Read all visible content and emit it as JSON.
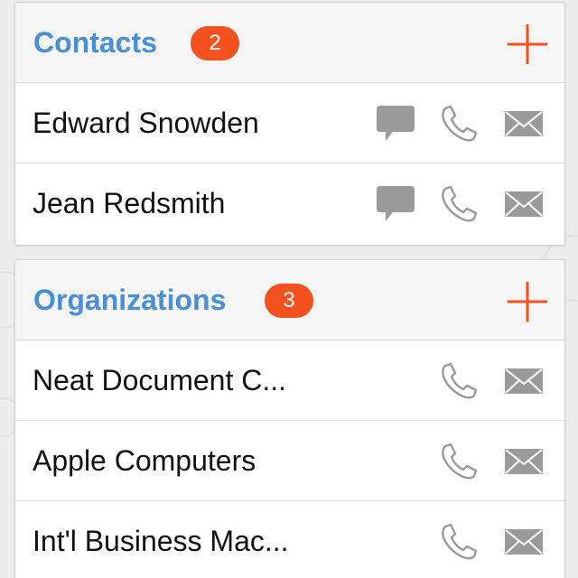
{
  "colors": {
    "accent_blue": "#4a8fd6",
    "accent_orange": "#f4511e",
    "icon_gray": "#9a9a9a",
    "background": "#ececec"
  },
  "contacts": {
    "title": "Contacts",
    "count": "2",
    "add_icon": "plus-icon",
    "items": [
      {
        "name": "Edward Snowden",
        "icons": [
          "message-icon",
          "phone-icon",
          "mail-icon"
        ]
      },
      {
        "name": "Jean Redsmith",
        "icons": [
          "message-icon",
          "phone-icon",
          "mail-icon"
        ]
      }
    ]
  },
  "organizations": {
    "title": "Organizations",
    "count": "3",
    "add_icon": "plus-icon",
    "items": [
      {
        "name": "Neat Document C...",
        "icons": [
          "phone-icon",
          "mail-icon"
        ]
      },
      {
        "name": "Apple Computers",
        "icons": [
          "phone-icon",
          "mail-icon"
        ]
      },
      {
        "name": "Int'l Business Mac...",
        "icons": [
          "phone-icon",
          "mail-icon"
        ]
      }
    ]
  }
}
